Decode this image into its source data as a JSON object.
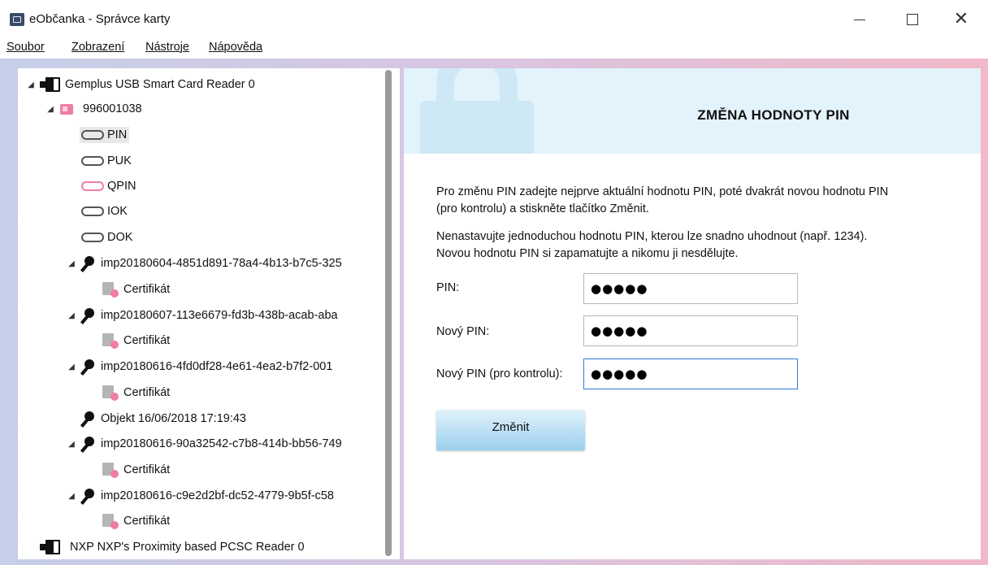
{
  "window": {
    "title": "eObčanka - Správce karty"
  },
  "menu": [
    "Soubor",
    "Zobrazení",
    "Nástroje",
    "Nápověda"
  ],
  "tree": [
    {
      "label": "Gemplus USB Smart Card Reader 0",
      "icon": "card-reader-icon",
      "expander": "◢"
    },
    {
      "label": "996001038",
      "icon": "smart-card-icon",
      "expander": "◢"
    },
    {
      "label": "PIN",
      "icon": "pin-icon",
      "expander": "",
      "selected": true
    },
    {
      "label": "PUK",
      "icon": "pin-icon",
      "expander": ""
    },
    {
      "label": "QPIN",
      "icon": "pin-icon-pink",
      "expander": ""
    },
    {
      "label": "IOK",
      "icon": "pin-icon",
      "expander": ""
    },
    {
      "label": "DOK",
      "icon": "pin-icon",
      "expander": ""
    },
    {
      "label": "imp20180604-4851d891-78a4-4b13-b7c5-325",
      "icon": "key-icon",
      "expander": "◢"
    },
    {
      "label": "Certifikát",
      "icon": "certificate-icon",
      "expander": ""
    },
    {
      "label": "imp20180607-113e6679-fd3b-438b-acab-aba",
      "icon": "key-icon",
      "expander": "◢"
    },
    {
      "label": "Certifikát",
      "icon": "certificate-icon",
      "expander": ""
    },
    {
      "label": "imp20180616-4fd0df28-4e61-4ea2-b7f2-001",
      "icon": "key-icon",
      "expander": "◢"
    },
    {
      "label": "Certifikát",
      "icon": "certificate-icon",
      "expander": ""
    },
    {
      "label": "Objekt 16/06/2018 17:19:43",
      "icon": "key-icon",
      "expander": ""
    },
    {
      "label": "imp20180616-90a32542-c7b8-414b-bb56-749",
      "icon": "key-icon",
      "expander": "◢"
    },
    {
      "label": "Certifikát",
      "icon": "certificate-icon",
      "expander": ""
    },
    {
      "label": "imp20180616-c9e2d2bf-dc52-4779-9b5f-c58",
      "icon": "key-icon",
      "expander": "◢"
    },
    {
      "label": "Certifikát",
      "icon": "certificate-icon",
      "expander": ""
    },
    {
      "label": "NXP NXP's Proximity based PCSC Reader 0",
      "icon": "card-reader-icon",
      "expander": ""
    }
  ],
  "panel": {
    "title": "ZMĚNA HODNOTY PIN",
    "para1_line1": "Pro změnu PIN zadejte nejprve aktuální hodnotu PIN, poté dvakrát novou hodnotu PIN",
    "para1_line2": "(pro kontrolu) a stiskněte tlačítko Změnit.",
    "para2_line1": "Nenastavujte jednoduchou hodnotu PIN, kterou lze snadno uhodnout (např. 1234).",
    "para2_line2": "Novou hodnotu PIN si zapamatujte a nikomu ji nesdělujte.",
    "fields": [
      {
        "label": "PIN:",
        "value": "●●●●●"
      },
      {
        "label": "Nový PIN:",
        "value": "●●●●●"
      },
      {
        "label": "Nový PIN (pro kontrolu):",
        "value": "●●●●●"
      }
    ],
    "button": "Změnit"
  },
  "colors": {
    "accent_pink": "#f07ea0",
    "header_bg": "#e3f3fb",
    "button_gradient_top": "#e2f2fb",
    "button_gradient_bottom": "#9ad0ee",
    "focus_border": "#2d7ad6"
  }
}
